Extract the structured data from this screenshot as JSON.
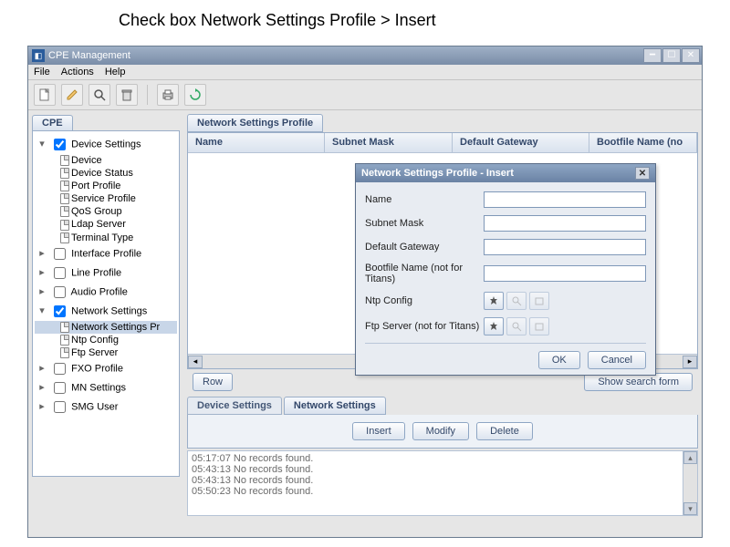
{
  "caption": "Check box Network Settings   Profile  >  Insert",
  "window": {
    "title": "CPE Management",
    "menus": [
      "File",
      "Actions",
      "Help"
    ]
  },
  "sidebar": {
    "tab": "CPE",
    "tree": [
      {
        "expander": "▾",
        "checked": true,
        "label": "Device Settings",
        "children": [
          "Device",
          "Device Status",
          "Port Profile",
          "Service Profile",
          "QoS Group",
          "Ldap Server",
          "Terminal Type"
        ]
      },
      {
        "expander": "▸",
        "checked": false,
        "label": "Interface Profile"
      },
      {
        "expander": "▸",
        "checked": false,
        "label": "Line Profile"
      },
      {
        "expander": "▸",
        "checked": false,
        "label": "Audio Profile"
      },
      {
        "expander": "▾",
        "checked": true,
        "label": "Network Settings",
        "children": [
          "Network Settings Pr",
          "Ntp Config",
          "Ftp Server"
        ],
        "selectedChild": 0
      },
      {
        "expander": "▸",
        "checked": false,
        "label": "FXO Profile"
      },
      {
        "expander": "▸",
        "checked": false,
        "label": "MN Settings"
      },
      {
        "expander": "▸",
        "checked": false,
        "label": "SMG User"
      }
    ]
  },
  "main": {
    "tab": "Network Settings Profile",
    "columns": [
      "Name",
      "Subnet Mask",
      "Default Gateway",
      "Bootfile Name (no"
    ],
    "row_label": "Row",
    "search_button": "Show search form",
    "lower_tabs": [
      "Device Settings",
      "Network Settings"
    ],
    "crud": {
      "insert": "Insert",
      "modify": "Modify",
      "delete": "Delete"
    },
    "logs": [
      "05:17:07 No records found.",
      "05:43:13 No records found.",
      "05:43:13 No records found.",
      "05:50:23 No records found."
    ]
  },
  "dialog": {
    "title": "Network Settings Profile - Insert",
    "fields": {
      "name": "Name",
      "subnet": "Subnet Mask",
      "gateway": "Default Gateway",
      "bootfile": "Bootfile Name (not for Titans)",
      "ntp": "Ntp Config",
      "ftp": "Ftp Server (not for Titans)"
    },
    "ok": "OK",
    "cancel": "Cancel"
  }
}
